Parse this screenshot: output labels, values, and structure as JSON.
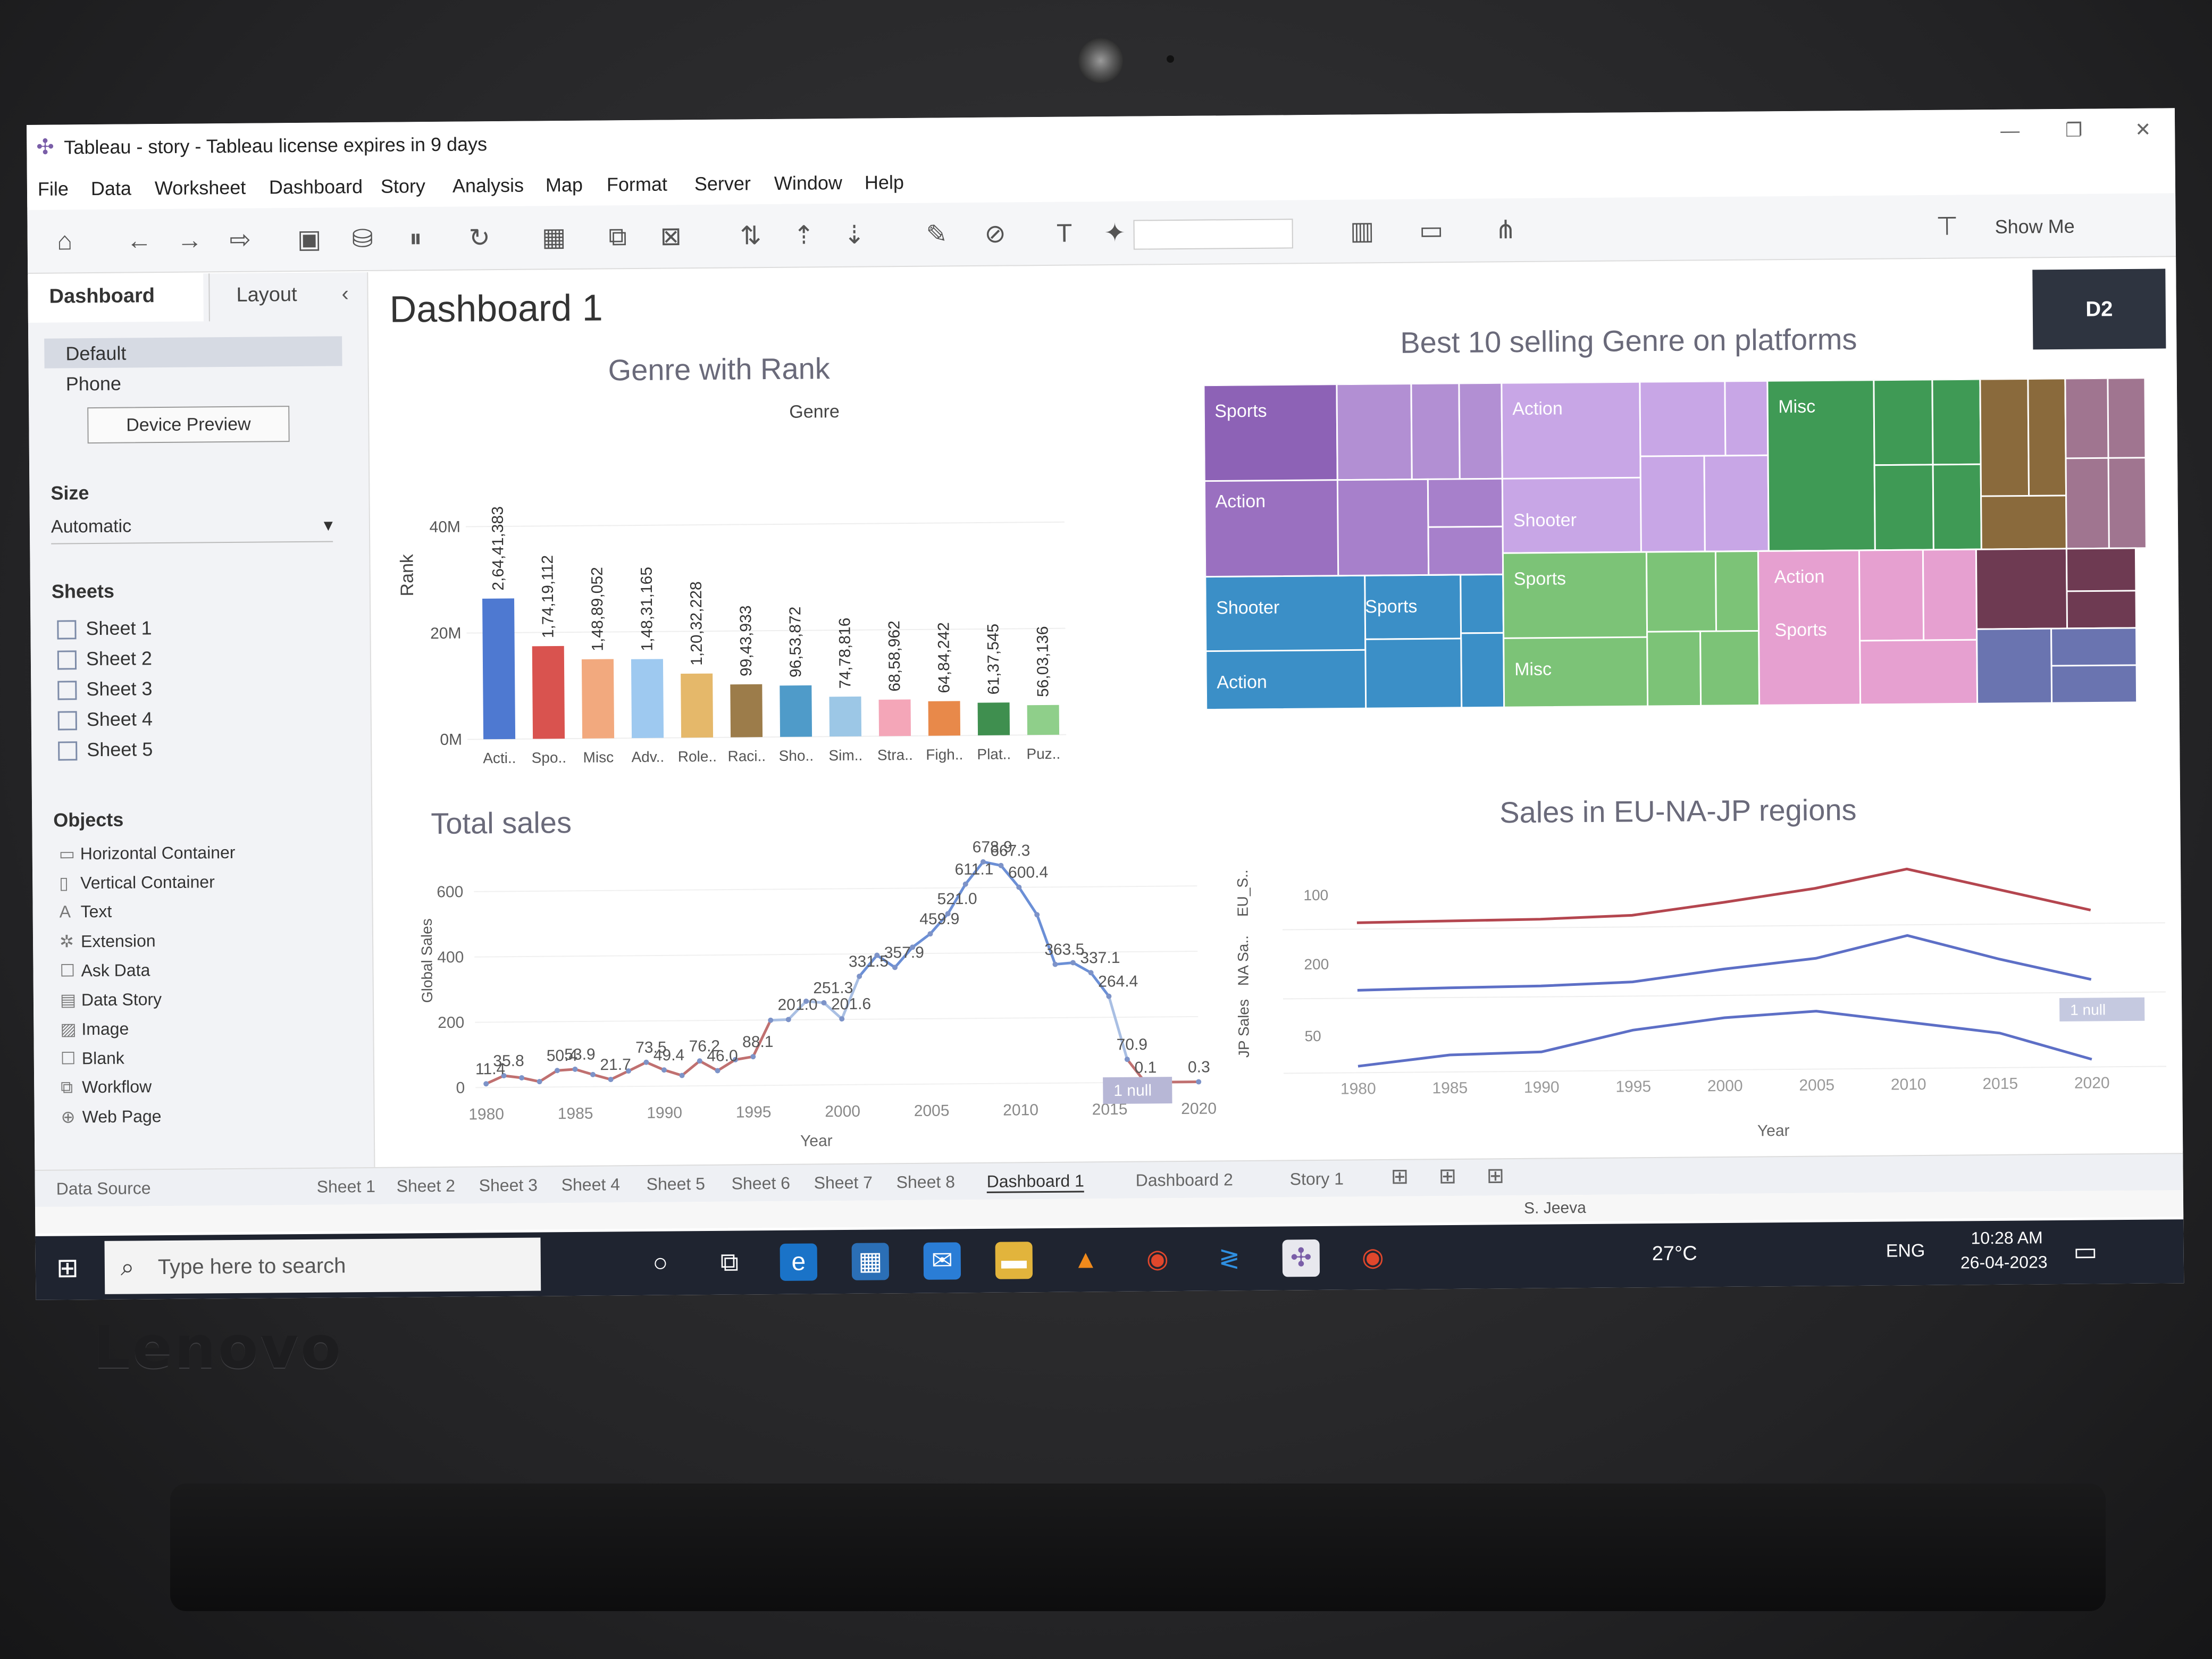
{
  "window": {
    "title": "Tableau - story - Tableau license expires in 9 days"
  },
  "menu": [
    "File",
    "Data",
    "Worksheet",
    "Dashboard",
    "Story",
    "Analysis",
    "Map",
    "Format",
    "Server",
    "Window",
    "Help"
  ],
  "toolbar": {
    "show_me": "Show Me"
  },
  "left_panel": {
    "tab_dashboard": "Dashboard",
    "tab_layout": "Layout",
    "devices": [
      "Default",
      "Phone"
    ],
    "device_preview": "Device Preview",
    "size_heading": "Size",
    "size_value": "Automatic",
    "sheets_heading": "Sheets",
    "sheets": [
      "Sheet 1",
      "Sheet 2",
      "Sheet 3",
      "Sheet 4",
      "Sheet 5"
    ],
    "objects_heading": "Objects",
    "objects": [
      "Horizontal Container",
      "Vertical Container",
      "Text",
      "Extension",
      "Ask Data",
      "Data Story",
      "Image",
      "Blank",
      "Workflow",
      "Web Page"
    ]
  },
  "dashboard": {
    "title": "Dashboard 1",
    "badge": "D2"
  },
  "charts_text": {
    "genre_title": "Genre with Rank",
    "genre_header": "Genre",
    "genre_ylabel": "Rank",
    "treemap_title": "Best 10 selling  Genre on platforms",
    "total_title": "Total sales",
    "total_ylabel": "Global Sales",
    "total_xlabel": "Year",
    "total_null": "1 null",
    "regions_title": "Sales in EU-NA-JP regions",
    "regions_xlabel": "Year",
    "regions_null": "1 null"
  },
  "chart_data": [
    {
      "type": "bar",
      "title": "Genre with Rank",
      "xlabel": "Genre",
      "ylabel": "Rank",
      "categories": [
        "Acti..",
        "Spo..",
        "Misc",
        "Adv..",
        "Role..",
        "Raci..",
        "Sho..",
        "Sim..",
        "Stra..",
        "Figh..",
        "Plat..",
        "Puz.."
      ],
      "labels": [
        "2,64,41,383",
        "1,74,19,112",
        "1,48,89,052",
        "1,48,31,165",
        "1,20,32,228",
        "99,43,933",
        "96,53,872",
        "74,78,816",
        "68,58,962",
        "64,84,242",
        "61,37,545",
        "56,03,136"
      ],
      "values": [
        26441383,
        17419112,
        14889052,
        14831165,
        12032228,
        9943933,
        9653872,
        7478816,
        6858962,
        6484242,
        6137545,
        5603136
      ],
      "colors": [
        "#4e79d1",
        "#d9534f",
        "#f2a97e",
        "#9ec9f0",
        "#e5b86a",
        "#9c7c4a",
        "#4f9bc9",
        "#9cc7e6",
        "#f4a6b8",
        "#e8894a",
        "#3f8f4f",
        "#8fcf8a"
      ],
      "yticks": [
        "40M",
        "20M",
        "0M"
      ],
      "ylim": [
        0,
        40000000
      ]
    },
    {
      "type": "treemap",
      "title": "Best 10 selling  Genre on platforms",
      "labels": [
        "Sports",
        "Action",
        "Shooter",
        "Sports",
        "Action",
        "Action",
        "Shooter",
        "Sports",
        "Misc",
        "Misc",
        "Action",
        "Sports"
      ]
    },
    {
      "type": "line",
      "title": "Total sales",
      "xlabel": "Year",
      "ylabel": "Global Sales",
      "x": [
        1980,
        1981,
        1982,
        1983,
        1984,
        1985,
        1986,
        1987,
        1988,
        1989,
        1990,
        1991,
        1992,
        1993,
        1994,
        1995,
        1996,
        1997,
        1998,
        1999,
        2000,
        2001,
        2002,
        2003,
        2004,
        2005,
        2006,
        2007,
        2008,
        2009,
        2010,
        2011,
        2012,
        2013,
        2014,
        2015,
        2016,
        2017,
        2020
      ],
      "values": [
        11.4,
        35.8,
        28.9,
        16.8,
        50.4,
        53.9,
        37.1,
        21.7,
        47.2,
        73.5,
        49.4,
        32.2,
        76.2,
        46.0,
        79.2,
        88.1,
        199.2,
        201.0,
        256.5,
        251.3,
        201.6,
        331.5,
        395.5,
        357.9,
        419.3,
        459.9,
        521.0,
        611.1,
        678.9,
        667.3,
        600.4,
        515.8,
        363.5,
        368.1,
        337.1,
        264.4,
        70.9,
        0.1,
        0.3
      ],
      "point_labels": [
        "11.4",
        "35.8",
        "50.4",
        "53.9",
        "21.7",
        "73.5",
        "49.4",
        "76.2",
        "46.0",
        "88.1",
        "201.0",
        "251.3",
        "201.6",
        "331.5",
        "357.9",
        "459.9",
        "521.0",
        "611.1",
        "678.9",
        "667.3",
        "600.4",
        "363.5",
        "337.1",
        "264.4",
        "70.9",
        "0.1",
        "0.3"
      ],
      "yticks": [
        0,
        200,
        400,
        600
      ],
      "xticks": [
        1980,
        1985,
        1990,
        1995,
        2000,
        2005,
        2010,
        2015,
        2020
      ],
      "ylim": [
        0,
        700
      ]
    },
    {
      "type": "line",
      "title": "Sales in EU-NA-JP regions",
      "xlabel": "Year",
      "axis_labels": [
        "EU_S..",
        "NA Sa..",
        "JP Sales"
      ],
      "xticks": [
        1980,
        1985,
        1990,
        1995,
        2000,
        2005,
        2010,
        2015,
        2020
      ],
      "series_ticks": [
        [
          "100"
        ],
        [
          "200"
        ],
        [
          "50"
        ]
      ],
      "colors": [
        "#b4464f",
        "#5d6fc6",
        "#5d6fc6"
      ],
      "x": [
        1980,
        1985,
        1990,
        1995,
        2000,
        2005,
        2010,
        2015,
        2020
      ],
      "series": [
        {
          "values": [
            2,
            4,
            6,
            12,
            35,
            60,
            95,
            55,
            15
          ]
        },
        {
          "values": [
            12,
            20,
            25,
            40,
            95,
            140,
            240,
            130,
            35
          ]
        },
        {
          "values": [
            1,
            10,
            12,
            30,
            40,
            45,
            35,
            25,
            2
          ]
        }
      ]
    }
  ],
  "sheet_tabs": [
    "Data Source",
    "Sheet 1",
    "Sheet 2",
    "Sheet 3",
    "Sheet 4",
    "Sheet 5",
    "Sheet 6",
    "Sheet 7",
    "Sheet 8",
    "Dashboard 1",
    "Dashboard 2",
    "Story 1"
  ],
  "status": {
    "user": "S. Jeeva"
  },
  "taskbar": {
    "search_placeholder": "Type here to search",
    "weather": "27°C",
    "lang": "ENG",
    "time": "10:28 AM",
    "date": "26-04-2023"
  },
  "device_brand": "Lenovo"
}
